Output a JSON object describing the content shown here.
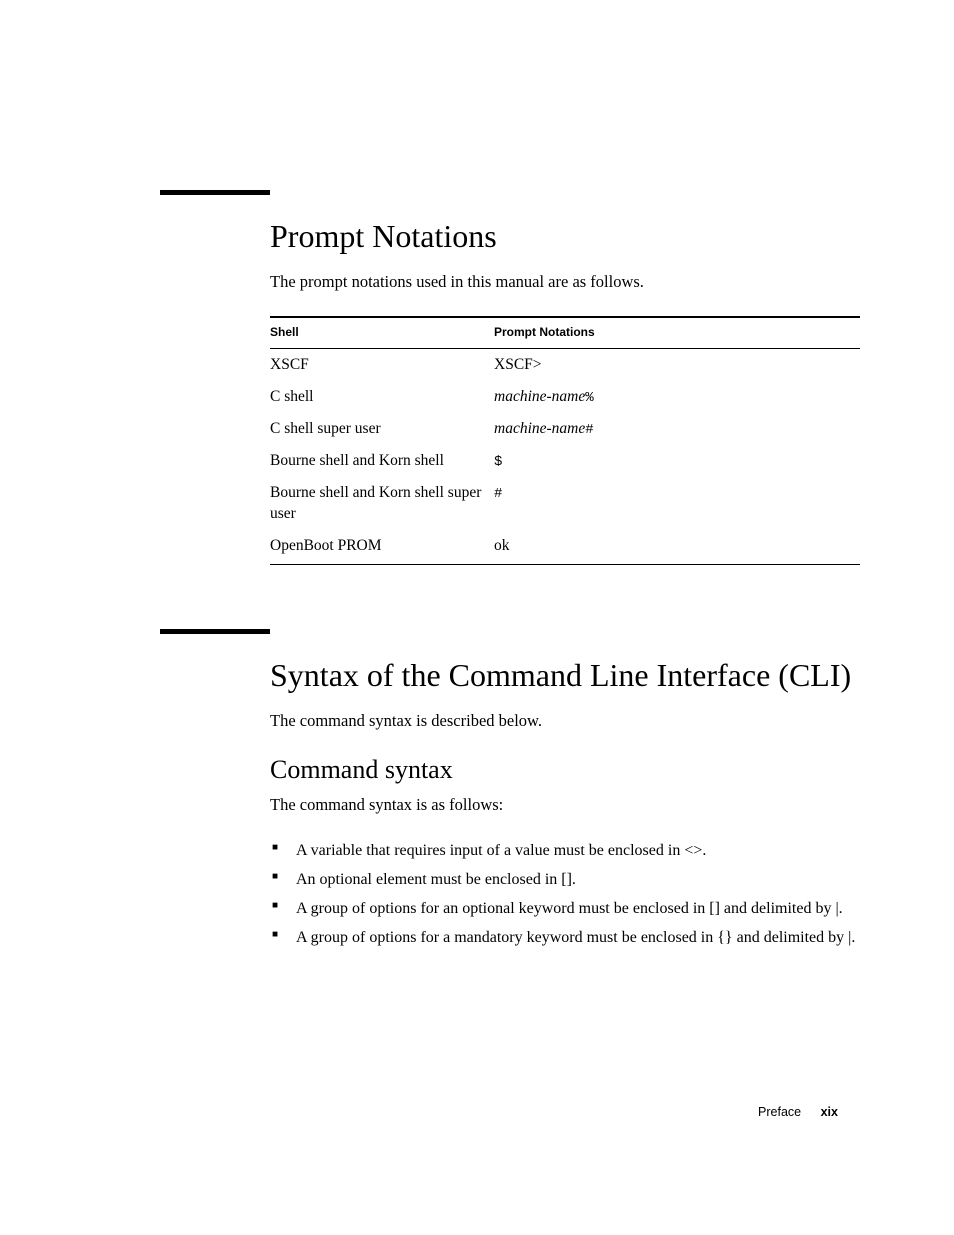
{
  "section1": {
    "heading": "Prompt Notations",
    "intro": "The prompt notations used in this manual are as follows.",
    "table": {
      "col1_header": "Shell",
      "col2_header": "Prompt Notations",
      "rows": [
        {
          "shell": "XSCF",
          "notation_text": "XSCF>"
        },
        {
          "shell": "C shell",
          "notation_italic": "machine-name",
          "notation_code": "%"
        },
        {
          "shell": "C shell super user",
          "notation_italic": "machine-name",
          "notation_code": "#"
        },
        {
          "shell": "Bourne shell and Korn shell",
          "notation_code": "$"
        },
        {
          "shell": "Bourne shell and Korn shell super user",
          "notation_code": "#"
        },
        {
          "shell": "OpenBoot PROM",
          "notation_text": "ok"
        }
      ]
    }
  },
  "section2": {
    "heading": "Syntax of the Command Line Interface (CLI)",
    "intro": "The command syntax is described below.",
    "subheading": "Command syntax",
    "subintro": "The command syntax is as follows:",
    "bullets": [
      "A variable that requires input of a value must be enclosed in <>.",
      "An optional element must be enclosed in [].",
      "A group of options for an optional keyword must be enclosed in [] and delimited by |.",
      "A group of options for a mandatory keyword must be enclosed in {} and delimited by |."
    ]
  },
  "footer": {
    "section": "Preface",
    "page": "xix"
  }
}
